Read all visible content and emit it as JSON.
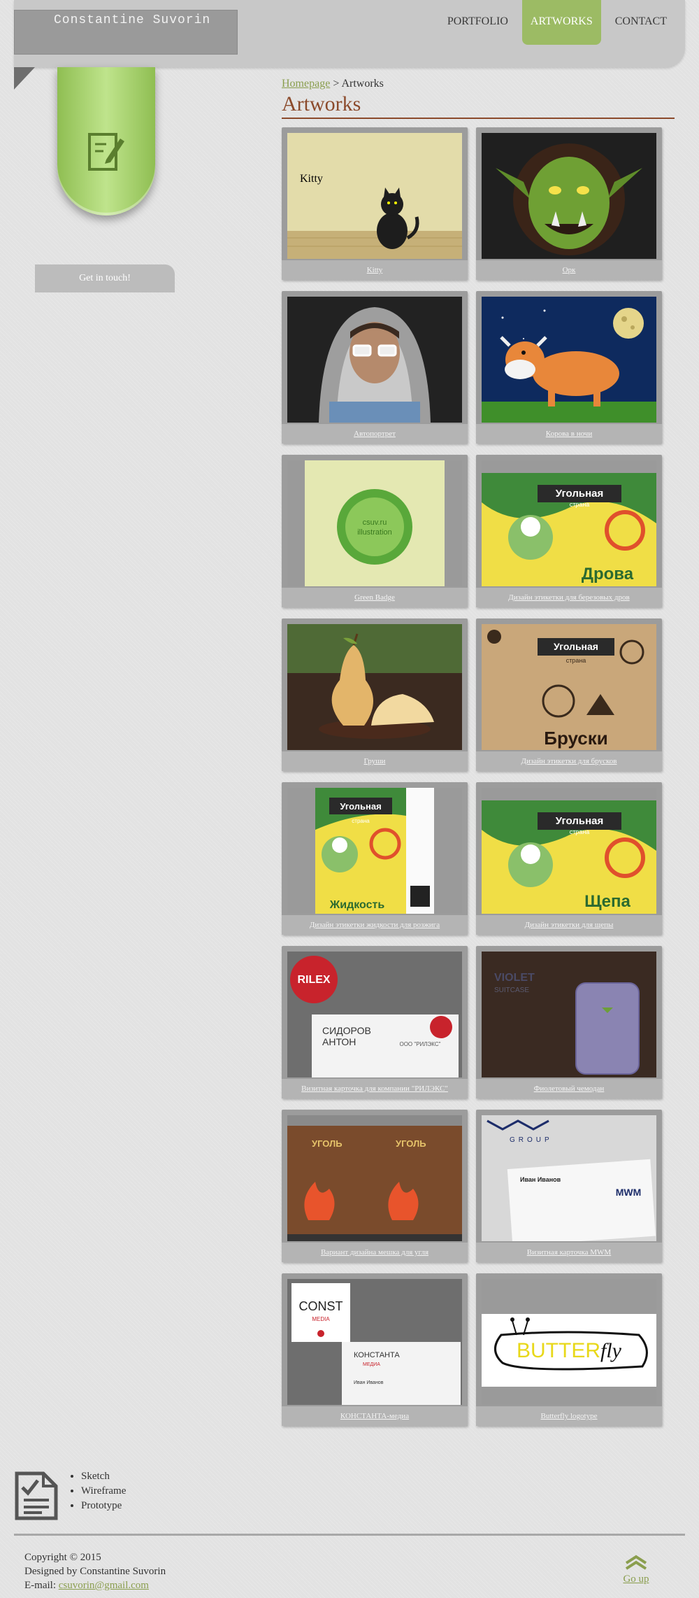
{
  "header": {
    "logo_text": "Constantine Suvorin",
    "nav": [
      {
        "label": "PORTFOLIO",
        "active": false
      },
      {
        "label": "ARTWORKS",
        "active": true
      },
      {
        "label": "CONTACT",
        "active": false
      }
    ]
  },
  "sidebar": {
    "ribbon_icon": "pencil-document-icon",
    "touch_label": "Get in touch!"
  },
  "main": {
    "breadcrumb": {
      "home": "Homepage",
      "separator": ">",
      "current": "Artworks"
    },
    "title": "Artworks",
    "items": [
      {
        "caption": "Kitty",
        "art": {
          "type": "kitty",
          "word": "Kitty"
        }
      },
      {
        "caption": "Орк",
        "art": {
          "type": "orc"
        }
      },
      {
        "caption": "Автопортрет",
        "art": {
          "type": "portrait"
        }
      },
      {
        "caption": "Корова в ночи",
        "art": {
          "type": "cow"
        }
      },
      {
        "caption": "Green Badge",
        "art": {
          "type": "badge",
          "line1": "csuv.ru",
          "line2": "illustration"
        }
      },
      {
        "caption": "Дизайн этикетки для березовых дров",
        "art": {
          "type": "label",
          "brand": "Угольная",
          "sub": "страна",
          "product": "Дрова"
        }
      },
      {
        "caption": "Груши",
        "art": {
          "type": "pear"
        }
      },
      {
        "caption": "Дизайн этикетки для брусков",
        "art": {
          "type": "kraft",
          "brand": "Угольная",
          "sub": "страна",
          "product": "Бруски"
        }
      },
      {
        "caption": "Дизайн этикетки жидкости для розжига",
        "art": {
          "type": "bottle",
          "brand": "Угольная",
          "sub": "страна",
          "product": "Жидкость"
        }
      },
      {
        "caption": "Дизайн этикетки для щепы",
        "art": {
          "type": "label",
          "brand": "Угольная",
          "sub": "страна",
          "product": "Щепа"
        }
      },
      {
        "caption": "Визитная карточка для компании \"РИЛЭКС\"",
        "art": {
          "type": "card",
          "logo": "RILEX",
          "name1": "СИДОРОВ",
          "name2": "АНТОН",
          "company": "ООО \"РИЛЭКС\""
        }
      },
      {
        "caption": "Фиолетовый чемодан",
        "art": {
          "type": "suitcase",
          "line1": "VIOLET",
          "line2": "SUITCASE"
        }
      },
      {
        "caption": "Вариант дизайна мешка для угля",
        "art": {
          "type": "bag",
          "left": "УГОЛЬ",
          "right": "УГОЛЬ"
        }
      },
      {
        "caption": "Визитная карточка MWM",
        "art": {
          "type": "mwm",
          "logo": "MWM",
          "group": "GROUP",
          "person": "Иван Иванов"
        }
      },
      {
        "caption": "КОНСТАНТА-медиа",
        "art": {
          "type": "const",
          "logo1": "CONST",
          "logo2": "MEDIA",
          "cardname": "КОНСТАНТА",
          "cardsub": "МЕДИА",
          "person": "Иван Иванов"
        }
      },
      {
        "caption": "Butterfly logotype",
        "art": {
          "type": "butterfly",
          "word1": "BUTTER",
          "word2": "fly"
        }
      }
    ]
  },
  "footer": {
    "icon": "checklist-document-icon",
    "list": [
      "Sketch",
      "Wireframe",
      "Prototype"
    ],
    "copyright": "Copyright © 2015",
    "designed": "Designed by Constantine Suvorin",
    "email_label": "E-mail:",
    "email": "csuvorin@gmail.com",
    "goup_label": "Go up"
  },
  "colors": {
    "accent": "#9cbb64",
    "title": "#8b4a2b",
    "link": "#8a9e4e"
  }
}
